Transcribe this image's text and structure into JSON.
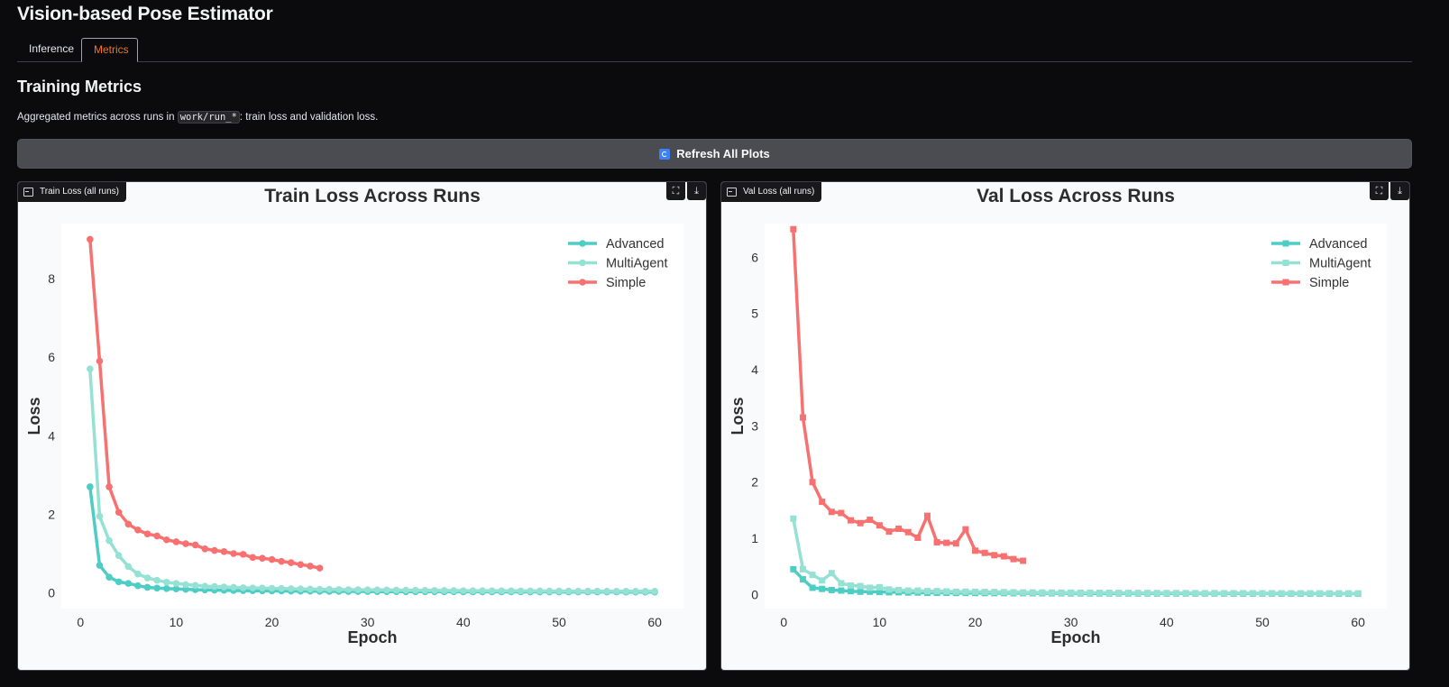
{
  "app": {
    "title": "Vision-based Pose Estimator"
  },
  "tabs": [
    {
      "label": "Inference"
    },
    {
      "label": "Metrics"
    }
  ],
  "section": {
    "title": "Training Metrics",
    "desc_before": "Aggregated metrics across runs in ",
    "desc_code": "work/run_*",
    "desc_after": ": train loss and validation loss."
  },
  "refresh_button": {
    "label": "Refresh All Plots",
    "icon": "refresh-icon",
    "icon_color": "#3b82f6"
  },
  "plots": [
    {
      "label": "Train Loss (all runs)",
      "actions": [
        "fullscreen-icon",
        "download-icon"
      ]
    },
    {
      "label": "Val Loss (all runs)",
      "actions": [
        "fullscreen-icon",
        "download-icon"
      ]
    }
  ],
  "colors": {
    "advanced": "#4ecdc4",
    "multiagent": "#95e1d3",
    "simple": "#f87171",
    "accent": "#f97316"
  },
  "chart_data": [
    {
      "type": "line",
      "title": "Train Loss Across Runs",
      "xlabel": "Epoch",
      "ylabel": "Loss",
      "xlim": [
        -2,
        63
      ],
      "ylim": [
        -0.4,
        9.4
      ],
      "xticks": [
        0,
        10,
        20,
        30,
        40,
        50,
        60
      ],
      "yticks": [
        0,
        2,
        4,
        6,
        8
      ],
      "marker": "circle",
      "legend": "top-right",
      "series": [
        {
          "name": "Advanced",
          "color": "#4ecdc4",
          "x": [
            1,
            2,
            3,
            4,
            5,
            6,
            7,
            8,
            9,
            10,
            11,
            12,
            13,
            14,
            15,
            16,
            17,
            18,
            19,
            20,
            21,
            22,
            23,
            24,
            25,
            26,
            27,
            28,
            29,
            30,
            31,
            32,
            33,
            34,
            35,
            36,
            37,
            38,
            39,
            40,
            41,
            42,
            43,
            44,
            45,
            46,
            47,
            48,
            49,
            50,
            51,
            52,
            53,
            54,
            55,
            56,
            57,
            58,
            59,
            60
          ],
          "y": [
            2.7,
            0.7,
            0.4,
            0.28,
            0.24,
            0.18,
            0.14,
            0.12,
            0.11,
            0.1,
            0.09,
            0.08,
            0.075,
            0.07,
            0.065,
            0.06,
            0.057,
            0.055,
            0.052,
            0.05,
            0.048,
            0.046,
            0.044,
            0.042,
            0.04,
            0.038,
            0.037,
            0.036,
            0.035,
            0.034,
            0.033,
            0.032,
            0.031,
            0.03,
            0.03,
            0.029,
            0.029,
            0.028,
            0.028,
            0.027,
            0.027,
            0.026,
            0.026,
            0.025,
            0.025,
            0.025,
            0.024,
            0.024,
            0.024,
            0.023,
            0.023,
            0.023,
            0.022,
            0.022,
            0.022,
            0.022,
            0.021,
            0.021,
            0.021,
            0.021
          ]
        },
        {
          "name": "MultiAgent",
          "color": "#95e1d3",
          "x": [
            1,
            2,
            3,
            4,
            5,
            6,
            7,
            8,
            9,
            10,
            11,
            12,
            13,
            14,
            15,
            16,
            17,
            18,
            19,
            20,
            21,
            22,
            23,
            24,
            25,
            26,
            27,
            28,
            29,
            30,
            31,
            32,
            33,
            34,
            35,
            36,
            37,
            38,
            39,
            40,
            41,
            42,
            43,
            44,
            45,
            46,
            47,
            48,
            49,
            50,
            51,
            52,
            53,
            54,
            55,
            56,
            57,
            58,
            59,
            60
          ],
          "y": [
            5.7,
            1.95,
            1.33,
            0.95,
            0.67,
            0.48,
            0.38,
            0.32,
            0.27,
            0.24,
            0.21,
            0.19,
            0.17,
            0.16,
            0.15,
            0.14,
            0.13,
            0.125,
            0.12,
            0.115,
            0.11,
            0.105,
            0.1,
            0.095,
            0.09,
            0.088,
            0.085,
            0.082,
            0.08,
            0.078,
            0.075,
            0.072,
            0.07,
            0.068,
            0.066,
            0.064,
            0.062,
            0.06,
            0.058,
            0.056,
            0.055,
            0.054,
            0.053,
            0.052,
            0.051,
            0.05,
            0.049,
            0.048,
            0.047,
            0.046,
            0.045,
            0.044,
            0.044,
            0.043,
            0.043,
            0.042,
            0.042,
            0.041,
            0.041,
            0.04
          ]
        },
        {
          "name": "Simple",
          "color": "#f87171",
          "x": [
            1,
            2,
            3,
            4,
            5,
            6,
            7,
            8,
            9,
            10,
            11,
            12,
            13,
            14,
            15,
            16,
            17,
            18,
            19,
            20,
            21,
            22,
            23,
            24,
            25
          ],
          "y": [
            9.0,
            5.9,
            2.7,
            2.05,
            1.75,
            1.6,
            1.5,
            1.45,
            1.35,
            1.3,
            1.25,
            1.22,
            1.12,
            1.08,
            1.05,
            1.0,
            0.98,
            0.9,
            0.88,
            0.85,
            0.8,
            0.77,
            0.72,
            0.68,
            0.63
          ]
        }
      ]
    },
    {
      "type": "line",
      "title": "Val Loss Across Runs",
      "xlabel": "Epoch",
      "ylabel": "Loss",
      "xlim": [
        -2,
        63
      ],
      "ylim": [
        -0.25,
        6.6
      ],
      "xticks": [
        0,
        10,
        20,
        30,
        40,
        50,
        60
      ],
      "yticks": [
        0,
        1,
        2,
        3,
        4,
        5,
        6
      ],
      "marker": "square",
      "legend": "top-right",
      "series": [
        {
          "name": "Advanced",
          "color": "#4ecdc4",
          "x": [
            1,
            2,
            3,
            4,
            5,
            6,
            7,
            8,
            9,
            10,
            11,
            12,
            13,
            14,
            15,
            16,
            17,
            18,
            19,
            20,
            21,
            22,
            23,
            24,
            25,
            26,
            27,
            28,
            29,
            30,
            31,
            32,
            33,
            34,
            35,
            36,
            37,
            38,
            39,
            40,
            41,
            42,
            43,
            44,
            45,
            46,
            47,
            48,
            49,
            50,
            51,
            52,
            53,
            54,
            55,
            56,
            57,
            58,
            59,
            60
          ],
          "y": [
            0.45,
            0.27,
            0.12,
            0.1,
            0.08,
            0.07,
            0.06,
            0.05,
            0.05,
            0.045,
            0.04,
            0.04,
            0.035,
            0.035,
            0.03,
            0.03,
            0.03,
            0.028,
            0.028,
            0.027,
            0.026,
            0.025,
            0.025,
            0.024,
            0.024,
            0.023,
            0.023,
            0.022,
            0.022,
            0.021,
            0.021,
            0.02,
            0.02,
            0.02,
            0.02,
            0.019,
            0.019,
            0.019,
            0.018,
            0.018,
            0.018,
            0.018,
            0.017,
            0.017,
            0.017,
            0.017,
            0.016,
            0.016,
            0.016,
            0.016,
            0.016,
            0.015,
            0.015,
            0.015,
            0.015,
            0.015,
            0.014,
            0.014,
            0.014,
            0.014
          ]
        },
        {
          "name": "MultiAgent",
          "color": "#95e1d3",
          "x": [
            1,
            2,
            3,
            4,
            5,
            6,
            7,
            8,
            9,
            10,
            11,
            12,
            13,
            14,
            15,
            16,
            17,
            18,
            19,
            20,
            21,
            22,
            23,
            24,
            25,
            26,
            27,
            28,
            29,
            30,
            31,
            32,
            33,
            34,
            35,
            36,
            37,
            38,
            39,
            40,
            41,
            42,
            43,
            44,
            45,
            46,
            47,
            48,
            49,
            50,
            51,
            52,
            53,
            54,
            55,
            56,
            57,
            58,
            59,
            60
          ],
          "y": [
            1.35,
            0.45,
            0.35,
            0.25,
            0.38,
            0.2,
            0.16,
            0.15,
            0.12,
            0.13,
            0.09,
            0.08,
            0.07,
            0.07,
            0.06,
            0.06,
            0.055,
            0.05,
            0.05,
            0.048,
            0.046,
            0.044,
            0.042,
            0.04,
            0.038,
            0.037,
            0.036,
            0.035,
            0.034,
            0.033,
            0.032,
            0.031,
            0.03,
            0.03,
            0.029,
            0.029,
            0.028,
            0.028,
            0.027,
            0.027,
            0.026,
            0.026,
            0.025,
            0.025,
            0.025,
            0.024,
            0.024,
            0.024,
            0.023,
            0.023,
            0.023,
            0.022,
            0.022,
            0.022,
            0.022,
            0.021,
            0.021,
            0.021,
            0.021,
            0.02
          ]
        },
        {
          "name": "Simple",
          "color": "#f87171",
          "x": [
            1,
            2,
            3,
            4,
            5,
            6,
            7,
            8,
            9,
            10,
            11,
            12,
            13,
            14,
            15,
            16,
            17,
            18,
            19,
            20,
            21,
            22,
            23,
            24,
            25
          ],
          "y": [
            6.5,
            3.15,
            2.0,
            1.65,
            1.47,
            1.45,
            1.32,
            1.27,
            1.33,
            1.23,
            1.12,
            1.17,
            1.11,
            1.01,
            1.4,
            0.93,
            0.92,
            0.91,
            1.16,
            0.78,
            0.74,
            0.7,
            0.68,
            0.63,
            0.6
          ]
        }
      ]
    }
  ]
}
